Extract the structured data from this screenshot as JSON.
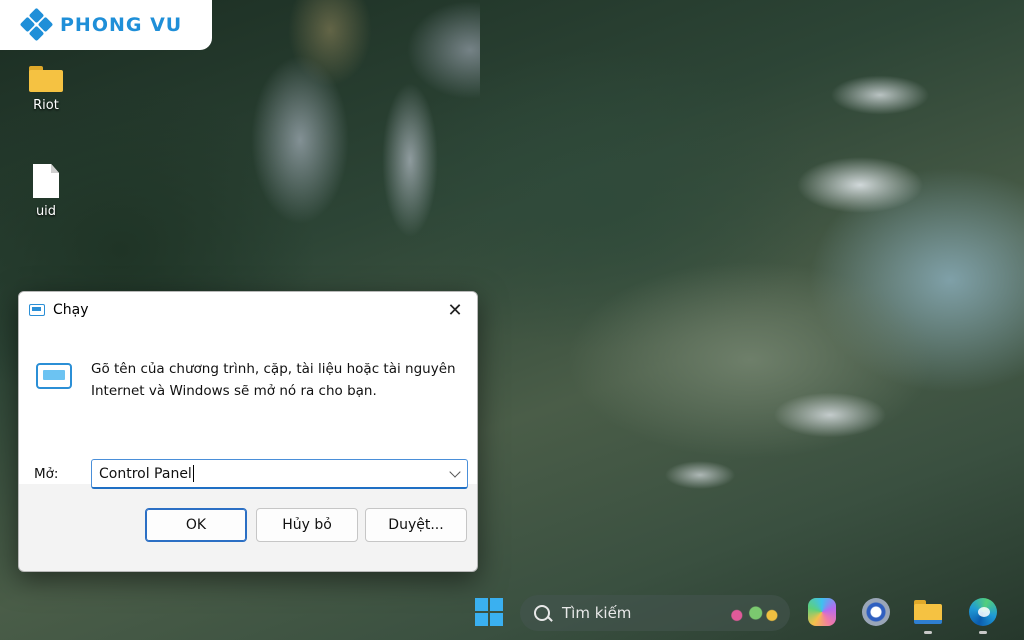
{
  "branding": {
    "logo_text": "PHONG VU"
  },
  "desktop": {
    "icons": [
      {
        "label": "Riot",
        "type": "folder-icon"
      },
      {
        "label": "uid",
        "type": "file-icon"
      }
    ]
  },
  "run_dialog": {
    "title": "Chạy",
    "description": "Gõ tên của chương trình, cặp, tài liệu hoặc tài nguyên Internet và Windows sẽ mở nó ra cho bạn.",
    "open_label": "Mở:",
    "open_value": "Control Panel",
    "buttons": {
      "ok": "OK",
      "cancel": "Hủy bỏ",
      "browse": "Duyệt..."
    },
    "close_glyph": "✕",
    "accent": "#2b6fc4"
  },
  "taskbar": {
    "search_placeholder": "Tìm kiếm",
    "apps": [
      "start-icon",
      "copilot-icon",
      "settings-icon",
      "file-explorer-icon",
      "edge-icon"
    ],
    "accent": "#3ab0f0"
  }
}
